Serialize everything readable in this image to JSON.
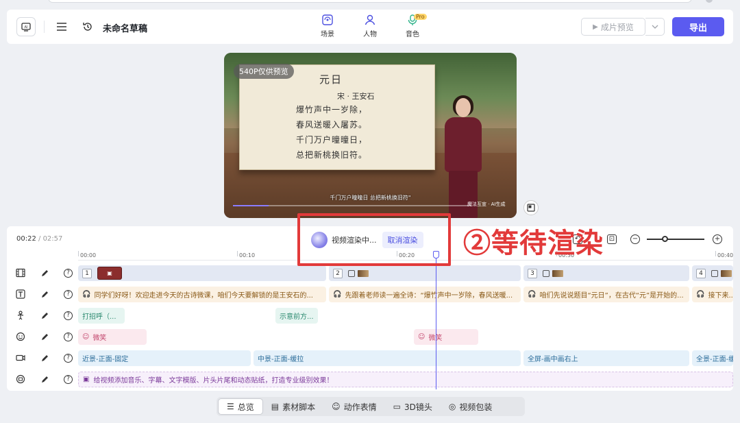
{
  "header": {
    "doc_title": "未命名草稿",
    "tabs": [
      {
        "label": "场景",
        "icon": "scene-icon"
      },
      {
        "label": "人物",
        "icon": "person-icon"
      },
      {
        "label": "音色",
        "icon": "microphone-icon",
        "badge": "Pro"
      }
    ],
    "preview_label": "成片预览",
    "export_label": "导出"
  },
  "video": {
    "quality_badge": "540P仅供预览",
    "poem": {
      "title": "元日",
      "author": "宋 · 王安石",
      "lines": [
        "爆竹声中一岁除，",
        "春风送暖入屠苏。",
        "千门万户曈曈日，",
        "总把新桃换旧符。"
      ]
    },
    "subtitle": "千门万户曈曈日 总把新桃换旧符\"",
    "watermark": "魔法互宣 · AI生成",
    "progress_fraction": 0.15
  },
  "timeline": {
    "current_time": "00:22",
    "separator": " / ",
    "total_time": "02:57",
    "render_status": "视频渲染中...",
    "cancel_render_label": "取消渲染",
    "ruler_ticks": [
      "00:00",
      "00:10",
      "00:20",
      "00:30",
      "00:40"
    ],
    "annotation": "②等待渲染",
    "rows": {
      "scene": [
        {
          "num": "1"
        },
        {
          "num": "2"
        },
        {
          "num": "3"
        },
        {
          "num": "4"
        }
      ],
      "script": [
        "同学们好呀！欢迎走进今天的古诗微课，咱们今天要解锁的是王安石的...",
        "先跟着老师读一遍全诗：“爆竹声中一岁除，春风送暖...",
        "咱们先说说题目“元日”，在古代“元”是开始的...",
        "接下来..."
      ],
      "gesture": [
        "打招呼（...",
        "示意前方..."
      ],
      "face": [
        "微笑",
        "微笑"
      ],
      "camera": [
        "近景-正面-固定",
        "中景-正面-缓拉",
        "全屏-画中画右上",
        "全景-正面-缓..."
      ],
      "pack": "给视频添加音乐、字幕、文字模版、片头片尾和动态贴纸，打造专业级别效果！"
    }
  },
  "bottom_tabs": [
    {
      "label": "总览",
      "icon": "list-icon",
      "active": true
    },
    {
      "label": "素材脚本",
      "icon": "film-icon",
      "active": false
    },
    {
      "label": "动作表情",
      "icon": "smile-icon",
      "active": false
    },
    {
      "label": "3D镜头",
      "icon": "camera-icon",
      "active": false
    },
    {
      "label": "视频包装",
      "icon": "package-icon",
      "active": false
    }
  ],
  "colors": {
    "accent": "#5b5bf0",
    "annotation_red": "#e23a3a"
  }
}
